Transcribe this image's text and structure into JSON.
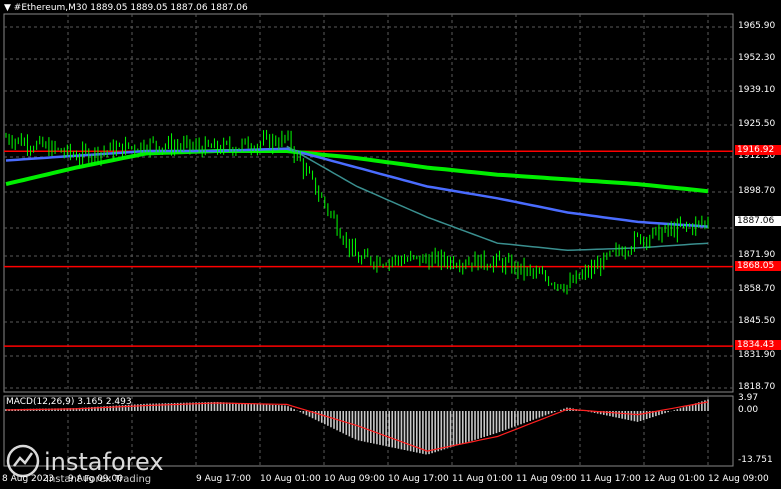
{
  "header": {
    "symbol": "#Ethereum,M30",
    "ohlc": "1889.05 1889.05 1887.06 1887.06"
  },
  "price_axis": [
    "1965.90",
    "1952.30",
    "1939.10",
    "1925.50",
    "1912.30",
    "1898.70",
    "1871.90",
    "1858.70",
    "1845.50",
    "1831.90",
    "1818.70"
  ],
  "current_price": "1887.06",
  "hlines": [
    {
      "label": "1916.92",
      "value": 1916.92,
      "color": "#ff0000"
    },
    {
      "label": "1868.05",
      "value": 1868.05,
      "color": "#ff0000"
    },
    {
      "label": "1834.43",
      "value": 1834.43,
      "color": "#ff0000"
    }
  ],
  "macd": {
    "label": "MACD(12,26,9) 3.165 2.493",
    "axis": [
      "3.97",
      "0.00",
      "-13.751"
    ]
  },
  "time_axis": [
    "8 Aug 2023",
    "9 Aug 09:00",
    "9 Aug 17:00",
    "10 Aug 01:00",
    "10 Aug 09:00",
    "10 Aug 17:00",
    "11 Aug 01:00",
    "11 Aug 09:00",
    "11 Aug 17:00",
    "12 Aug 01:00",
    "12 Aug 09:00"
  ],
  "logo": {
    "name": "instaforex",
    "tagline": "Instant Forex Trading"
  },
  "colors": {
    "candle": "#00ff00",
    "ma_fast": "#3a8f8f",
    "ma_mid": "#4a6cff",
    "ma_slow": "#00ee00",
    "signal": "#ff2020",
    "hist": "#c8c8c8",
    "grid": "#5a5a5a"
  },
  "chart_data": {
    "type": "line",
    "title": "#Ethereum,M30",
    "y_range": [
      1815,
      1975
    ],
    "close_series": {
      "x": [
        "8 Aug",
        "9 Aug 09:00",
        "9 Aug 17:00",
        "10 Aug 01:00",
        "10 Aug 09:00",
        "10 Aug 17:00",
        "11 Aug 01:00",
        "11 Aug 09:00",
        "11 Aug 17:00",
        "12 Aug 01:00",
        "12 Aug 09:00"
      ],
      "values": [
        1923,
        1915,
        1920,
        1918,
        1922,
        1871,
        1871,
        1870,
        1860,
        1880,
        1887
      ]
    },
    "ma_slow": [
      1903,
      1910,
      1916,
      1917,
      1917,
      1914,
      1910,
      1907,
      1905,
      1903,
      1900
    ],
    "ma_mid": [
      1913,
      1915,
      1917,
      1917,
      1918,
      1910,
      1902,
      1897,
      1891,
      1887,
      1885
    ],
    "ma_fast": [
      null,
      null,
      null,
      null,
      1919,
      1902,
      1889,
      1878,
      1875,
      1876,
      1878
    ],
    "macd_hist": [
      0.5,
      0.8,
      2,
      2.5,
      1.5,
      -8,
      -12,
      -6,
      1,
      -3,
      3.2
    ],
    "macd_signal": [
      0.3,
      0.6,
      1.5,
      2.2,
      1.8,
      -4,
      -11,
      -7,
      0.5,
      -1,
      2.5
    ]
  }
}
